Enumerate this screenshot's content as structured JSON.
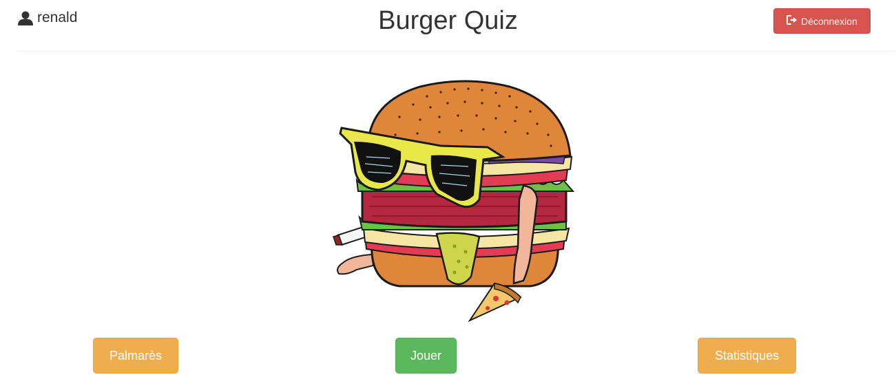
{
  "header": {
    "username": "renald",
    "title": "Burger Quiz",
    "logout_label": "Déconnexion"
  },
  "icons": {
    "user": "user-icon",
    "logout": "log-out-icon",
    "hero": "burger-mascot-illustration"
  },
  "actions": {
    "palmares_label": "Palmarès",
    "play_label": "Jouer",
    "stats_label": "Statistiques"
  },
  "colors": {
    "danger": "#d9534f",
    "warning": "#f0ad4e",
    "success": "#5cb85c"
  }
}
